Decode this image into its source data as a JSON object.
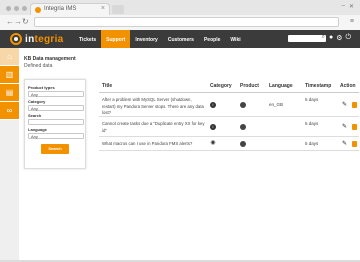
{
  "browser": {
    "tab_title": "Integria IMS",
    "close_glyph": "×"
  },
  "header": {
    "logo_prefix": "in",
    "logo_suffix": "tegria",
    "nav": [
      "Tickets",
      "Support",
      "Inventory",
      "Customers",
      "People",
      "Wiki"
    ],
    "active_nav": "Support"
  },
  "page": {
    "title": "KB Data management",
    "subtitle": "Defined data"
  },
  "filter": {
    "product_types_label": "Product types",
    "product_types_value": "Any",
    "category_label": "Category",
    "category_value": "Any",
    "search_label": "Search",
    "search_value": "",
    "language_label": "Language",
    "language_value": "Any",
    "search_button": "Search"
  },
  "table": {
    "headers": [
      "Title",
      "Category",
      "Product",
      "Language",
      "Timestamp",
      "Action"
    ],
    "rows": [
      {
        "title": "After a problem with MySQL Server (shutdown, restart) my Pandora Server stops. There are any data lost?",
        "language": "en_GB",
        "timestamp": "5 days"
      },
      {
        "title": "Cannot create tasks due a \"Duplicate entry XX for key id\"",
        "language": "",
        "timestamp": "5 days"
      },
      {
        "title": "What macros can I use in Pandora FMS alerts?",
        "language": "",
        "timestamp": "5 days"
      }
    ]
  },
  "colors": {
    "accent": "#f39200",
    "header_bg": "#3b3b3b"
  },
  "icons": {
    "sidebar": [
      "home-icon",
      "book-icon",
      "folder-icon",
      "link-icon"
    ]
  }
}
